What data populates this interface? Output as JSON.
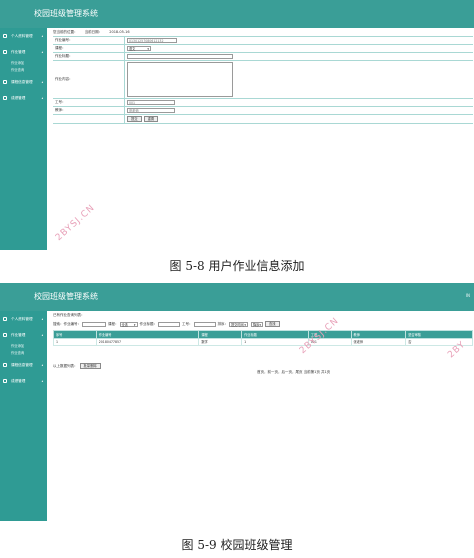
{
  "shot_a": {
    "app_title": "校园班级管理系统",
    "sidebar": [
      {
        "label": "个人资料管理",
        "subs": []
      },
      {
        "label": "作业管理",
        "subs": [
          "作业添加",
          "作业查询"
        ]
      },
      {
        "label": "课程信息管理",
        "subs": []
      },
      {
        "label": "成绩管理",
        "subs": []
      }
    ],
    "breadcrumb": {
      "left": "您当前的位置：",
      "mid": "当前日期：",
      "date": "2018-05-16"
    },
    "form": {
      "number_label": "作业编号：",
      "number_value": "01301257080612132",
      "course_label": "课程：",
      "course_value": "语文",
      "title_label": "作业标题：",
      "content_label": "作业内容：",
      "worker_label": "工号：",
      "worker_value": "001",
      "teacher_label": "教师：",
      "teacher_value": "张老师",
      "submit_label": "提交",
      "reset_label": "重置"
    },
    "watermark": "2BYSJ.CN",
    "caption": "图 5-8 用户作业信息添加"
  },
  "shot_b": {
    "app_title": "校园班级管理系统",
    "topright": "IN",
    "sidebar": [
      {
        "label": "个人资料管理",
        "subs": []
      },
      {
        "label": "作业管理",
        "subs": [
          "作业添加",
          "作业查询"
        ]
      },
      {
        "label": "课程信息管理",
        "subs": []
      },
      {
        "label": "成绩管理",
        "subs": []
      }
    ],
    "breadcrumb": "已有作业查询列表：",
    "search": {
      "field_label": "搜索：",
      "number_label": "作业编号：",
      "course_label": "课程：",
      "course_value": "全选",
      "title_label": "作业标题：",
      "worker_label": "工号：",
      "sort_label": "排序：",
      "sort_value": "提交时间",
      "order_value": "降序",
      "search_button": "查找"
    },
    "table": {
      "headers": [
        "序号",
        "作业编号",
        "课程",
        "作业标题",
        "工号",
        "教师",
        "是否审核"
      ],
      "rows": [
        [
          "1",
          "20180477857",
          "数学",
          "1",
          "001",
          "张老师",
          "否"
        ]
      ]
    },
    "footer": {
      "select_label": "以上数据列表：",
      "action_button": "批量删除"
    },
    "pager": "首页，前一页，后一页，尾页 当前第1页 共1页",
    "watermarks": [
      "2BYSJ.CN",
      "2BY"
    ],
    "caption": "图 5-9 校园班级管理"
  }
}
